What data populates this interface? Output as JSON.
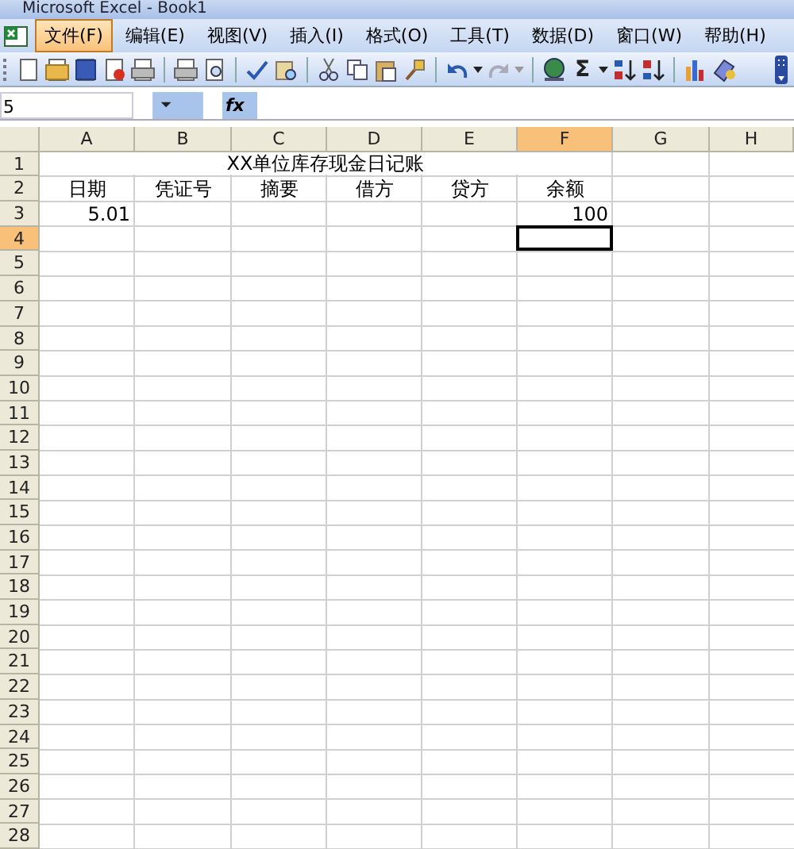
{
  "window": {
    "title": "Microsoft Excel - Book1"
  },
  "menu": [
    {
      "label": "文件(F)",
      "selected": true
    },
    {
      "label": "编辑(E)",
      "selected": false
    },
    {
      "label": "视图(V)",
      "selected": false
    },
    {
      "label": "插入(I)",
      "selected": false
    },
    {
      "label": "格式(O)",
      "selected": false
    },
    {
      "label": "工具(T)",
      "selected": false
    },
    {
      "label": "数据(D)",
      "selected": false
    },
    {
      "label": "窗口(W)",
      "selected": false
    },
    {
      "label": "帮助(H)",
      "selected": false
    }
  ],
  "toolbar": {
    "sum_symbol": "Σ"
  },
  "formula_bar": {
    "name_box": "5",
    "fx": "fx"
  },
  "columns": [
    {
      "label": "A",
      "selected": false
    },
    {
      "label": "B",
      "selected": false
    },
    {
      "label": "C",
      "selected": false
    },
    {
      "label": "D",
      "selected": false
    },
    {
      "label": "E",
      "selected": false
    },
    {
      "label": "F",
      "selected": true
    },
    {
      "label": "G",
      "selected": false
    },
    {
      "label": "H",
      "selected": false
    }
  ],
  "rows": [
    {
      "header": "1",
      "selected": false,
      "kind": "title",
      "text": "XX单位库存现金日记账"
    },
    {
      "header": "2",
      "selected": false,
      "kind": "heading",
      "cells": {
        "A": "日期",
        "B": "凭证号",
        "C": "摘要",
        "D": "借方",
        "E": "贷方",
        "F": "余额"
      }
    },
    {
      "header": "3",
      "selected": false,
      "kind": "values",
      "cells": {
        "A": "5.01",
        "F": "100"
      }
    },
    {
      "header": "4",
      "selected": true
    },
    {
      "header": "5",
      "selected": false
    },
    {
      "header": "6",
      "selected": false
    },
    {
      "header": "7",
      "selected": false
    },
    {
      "header": "8",
      "selected": false
    },
    {
      "header": "9",
      "selected": false
    },
    {
      "header": "10",
      "selected": false
    },
    {
      "header": "11",
      "selected": false
    },
    {
      "header": "12",
      "selected": false
    },
    {
      "header": "13",
      "selected": false
    },
    {
      "header": "14",
      "selected": false
    },
    {
      "header": "15",
      "selected": false
    },
    {
      "header": "16",
      "selected": false
    },
    {
      "header": "17",
      "selected": false
    },
    {
      "header": "18",
      "selected": false
    },
    {
      "header": "19",
      "selected": false
    },
    {
      "header": "20",
      "selected": false
    },
    {
      "header": "21",
      "selected": false
    },
    {
      "header": "22",
      "selected": false
    },
    {
      "header": "23",
      "selected": false
    },
    {
      "header": "24",
      "selected": false
    },
    {
      "header": "25",
      "selected": false
    },
    {
      "header": "26",
      "selected": false
    },
    {
      "header": "27",
      "selected": false
    },
    {
      "header": "28",
      "selected": false
    }
  ]
}
